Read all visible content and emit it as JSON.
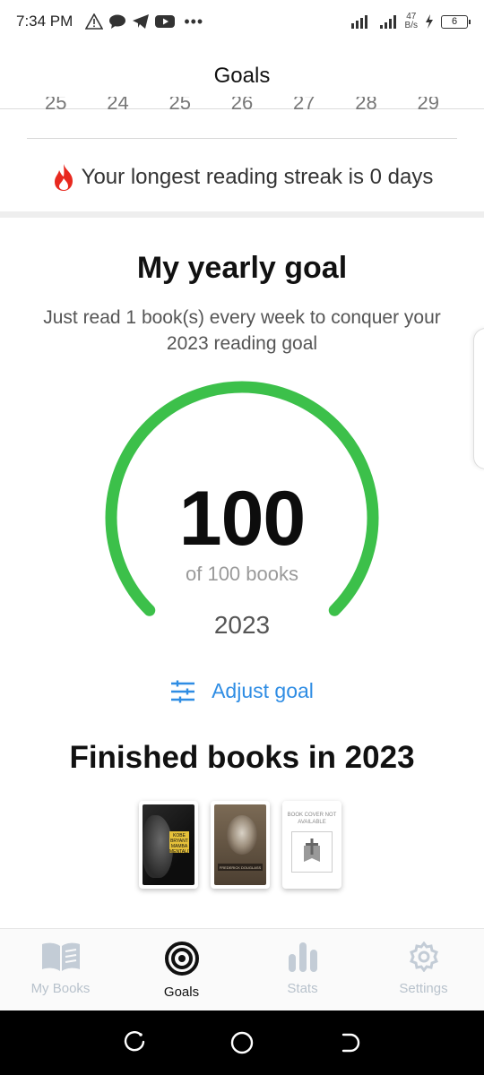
{
  "status_bar": {
    "time": "7:34 PM",
    "net_speed_value": "47",
    "net_speed_unit": "B/s",
    "battery": "6"
  },
  "header": {
    "title": "Goals"
  },
  "week_strip": {
    "days": [
      "25",
      "24",
      "25",
      "26",
      "27",
      "28",
      "29"
    ]
  },
  "streak": {
    "text": "Your longest reading streak is 0 days"
  },
  "yearly_goal": {
    "title": "My yearly goal",
    "subtitle": "Just read 1 book(s) every week to conquer your 2023 reading goal",
    "progress_value": "100",
    "progress_of": "of 100 books",
    "year": "2023",
    "progress_fraction": 1.0,
    "ring_color": "#3cc04a",
    "adjust_label": "Adjust goal",
    "accent": "#2f8de4"
  },
  "finished": {
    "title": "Finished books in 2023",
    "books": [
      {
        "icon": "kobe-bryant-cover",
        "cover_text": "KOBE BRYANT MAMBA MENTALITY"
      },
      {
        "icon": "frederick-douglass-cover",
        "cover_text": "FREDERICK DOUGLASS"
      },
      {
        "icon": "cover-not-available",
        "cover_text": "BOOK COVER NOT AVAILABLE"
      }
    ]
  },
  "bottom_nav": {
    "items": [
      {
        "label": "My Books",
        "icon": "book-icon",
        "active": false
      },
      {
        "label": "Goals",
        "icon": "target-icon",
        "active": true
      },
      {
        "label": "Stats",
        "icon": "bar-chart-icon",
        "active": false
      },
      {
        "label": "Settings",
        "icon": "gear-icon",
        "active": false
      }
    ]
  }
}
